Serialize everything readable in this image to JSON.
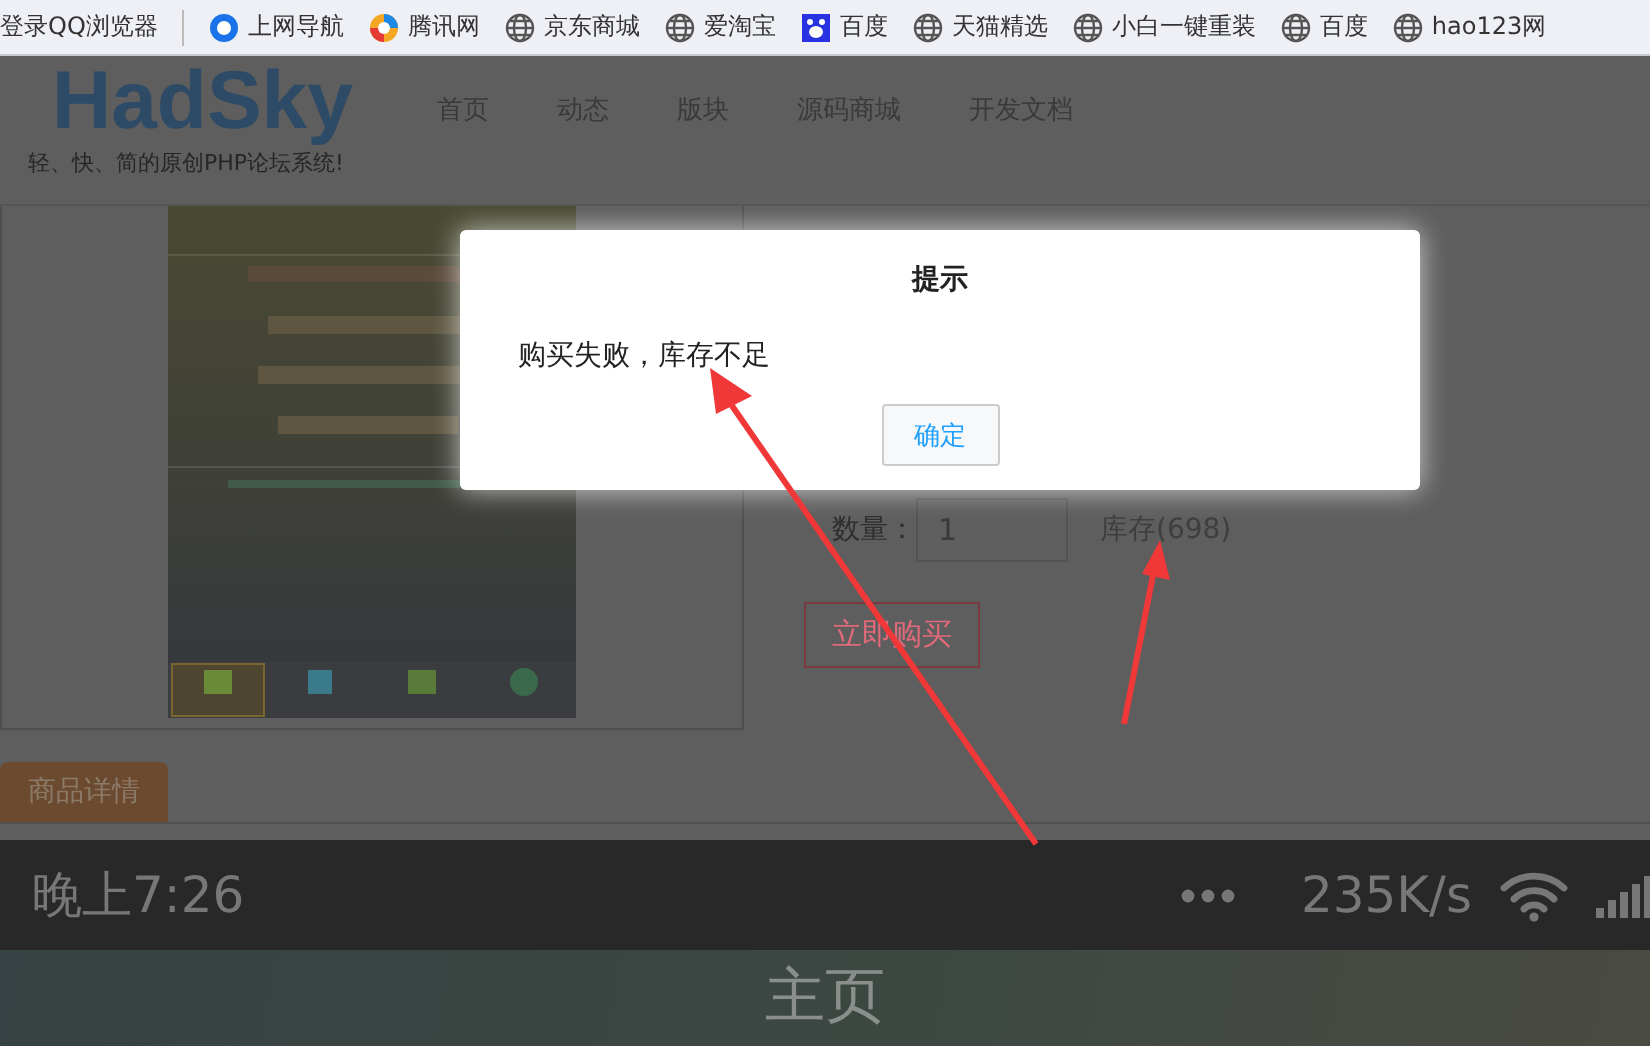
{
  "bookmarks": [
    {
      "label": "登录QQ浏览器",
      "kind": "plain"
    },
    {
      "label": "上网导航",
      "kind": "browser"
    },
    {
      "label": "腾讯网",
      "kind": "tencent"
    },
    {
      "label": "京东商城",
      "kind": "globe"
    },
    {
      "label": "爱淘宝",
      "kind": "globe"
    },
    {
      "label": "百度",
      "kind": "paw"
    },
    {
      "label": "天猫精选",
      "kind": "globe"
    },
    {
      "label": "小白一键重装",
      "kind": "globe"
    },
    {
      "label": "百度",
      "kind": "globe"
    },
    {
      "label": "hao123网",
      "kind": "globe"
    }
  ],
  "site": {
    "logo": "HadSky",
    "tagline": "轻、快、简的原创PHP论坛系统!",
    "nav": [
      "首页",
      "动态",
      "版块",
      "源码商城",
      "开发文档"
    ]
  },
  "product": {
    "quantity_label": "数量：",
    "quantity": "1",
    "stock": "库存(698)",
    "buy_button": "立即购买",
    "detail_tab": "商品详情"
  },
  "dialog": {
    "title": "提示",
    "message": "购买失败，库存不足",
    "button": "确定"
  },
  "phone_status": {
    "time": "晚上7:26",
    "speed": "235K/s",
    "page_title": "主页"
  }
}
